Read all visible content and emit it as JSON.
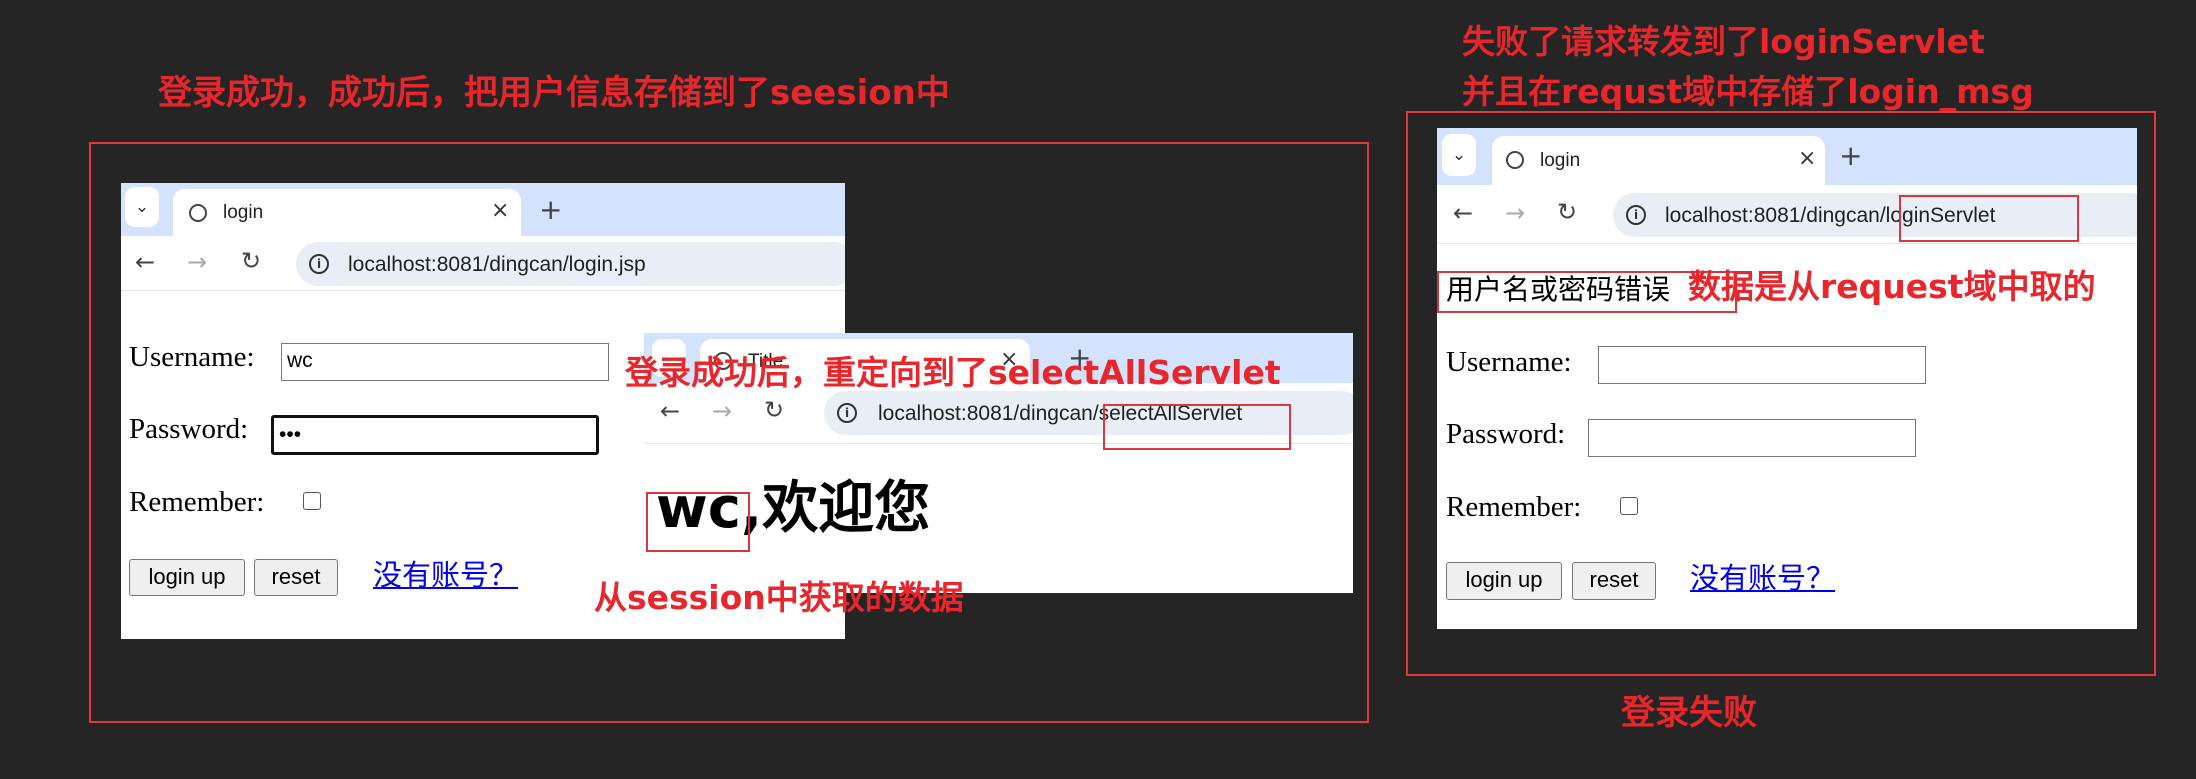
{
  "annotations": {
    "success_title": "登录成功，成功后，把用户信息存储到了seesion中",
    "redirect_note": "登录成功后，重定向到了selectAllServlet",
    "session_note": "从session中获取的数据",
    "fail_line1": "失败了请求转发到了loginServlet",
    "fail_line2": "并且在requst域中存储了login_msg",
    "request_note": "数据是从request域中取的",
    "fail_title": "登录失败"
  },
  "colors": {
    "annotation": "#e8262b",
    "tabbar": "#d3e3fd",
    "link": "#0000ee",
    "background": "#252525"
  },
  "window_login": {
    "tab_title": "login",
    "url_host": "localhost:8081/dingcan/login.jsp",
    "username_label": "Username:",
    "username_value": "wc",
    "password_label": "Password:",
    "password_value": "•••",
    "remember_label": "Remember:",
    "login_button": "login up",
    "reset_button": "reset",
    "register_link": "没有账号？"
  },
  "window_select": {
    "tab_title": "Title",
    "url_host": "localhost:8081/dingcan",
    "url_path": "/selectAllServlet",
    "greeting_name": "wc,",
    "greeting_text": "欢迎您"
  },
  "window_fail": {
    "tab_title": "login",
    "url_host": "localhost:8081/dingcan",
    "url_path": "/loginServlet",
    "error_msg": "用户名或密码错误",
    "username_label": "Username:",
    "username_value": "",
    "password_label": "Password:",
    "password_value": "",
    "remember_label": "Remember:",
    "login_button": "login up",
    "reset_button": "reset",
    "register_link": "没有账号？"
  },
  "icons": [
    "chevron-down-icon",
    "globe-icon",
    "close-icon",
    "plus-icon",
    "back-arrow-icon",
    "forward-arrow-icon",
    "reload-icon",
    "info-icon",
    "checkbox"
  ]
}
